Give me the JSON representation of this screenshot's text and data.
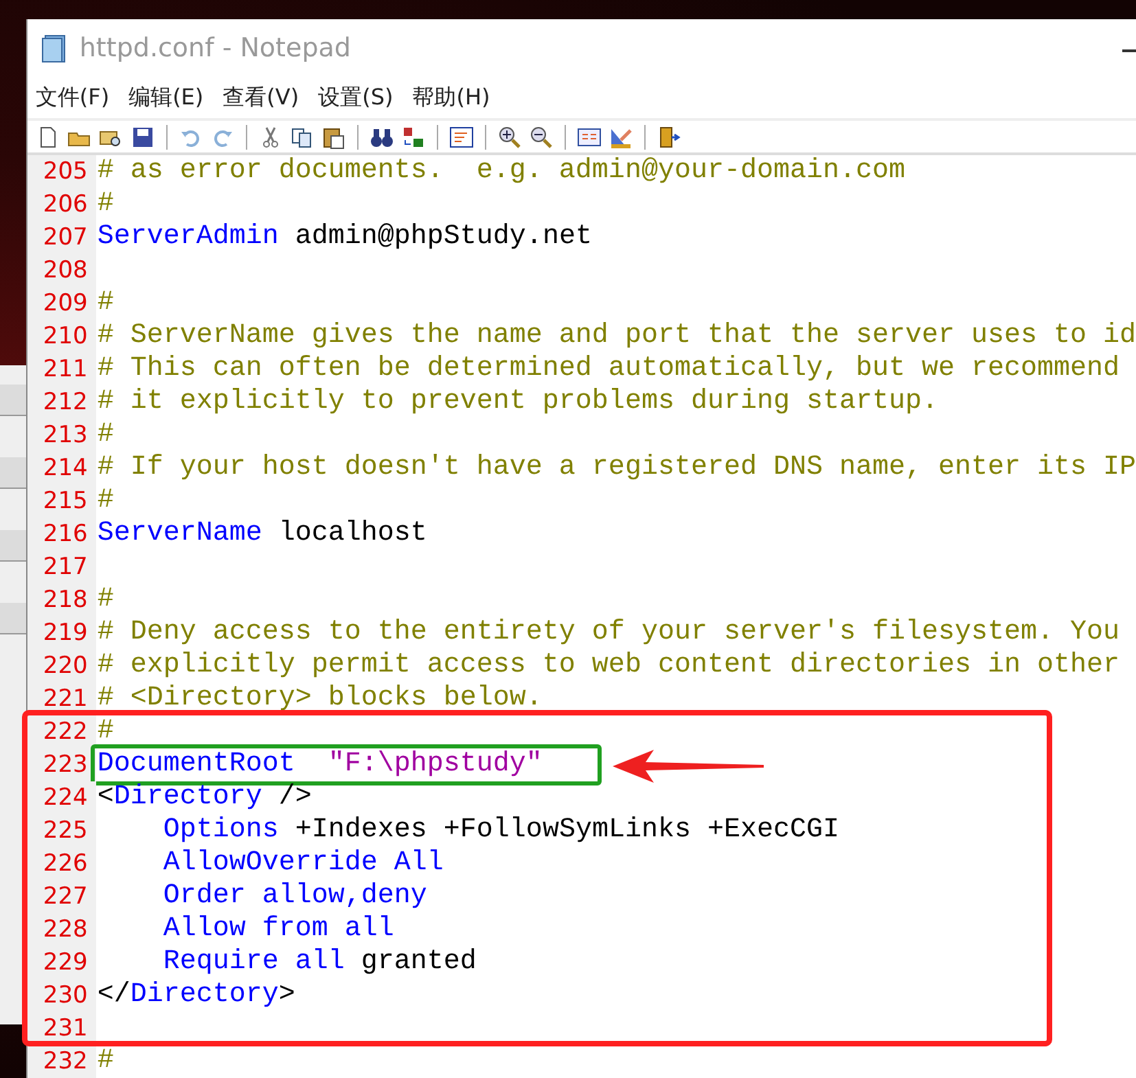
{
  "window": {
    "title": "httpd.conf - Notepad"
  },
  "menu": [
    "文件(F)",
    "编辑(E)",
    "查看(V)",
    "设置(S)",
    "帮助(H)"
  ],
  "lines": [
    {
      "number": "205",
      "segments": [
        {
          "kind": "comment",
          "text": "# as error documents.  e.g. admin@your-domain.com"
        }
      ]
    },
    {
      "number": "206",
      "segments": [
        {
          "kind": "comment",
          "text": "#"
        }
      ]
    },
    {
      "number": "207",
      "segments": [
        {
          "kind": "keyword",
          "text": "ServerAdmin"
        },
        {
          "kind": "plain",
          "text": " admin@phpStudy.net"
        }
      ]
    },
    {
      "number": "208"
    },
    {
      "number": "209",
      "segments": [
        {
          "kind": "comment",
          "text": "#"
        }
      ]
    },
    {
      "number": "210",
      "segments": [
        {
          "kind": "comment",
          "text": "# ServerName gives the name and port that the server uses to id"
        }
      ]
    },
    {
      "number": "211",
      "segments": [
        {
          "kind": "comment",
          "text": "# This can often be determined automatically, but we recommend"
        }
      ]
    },
    {
      "number": "212",
      "segments": [
        {
          "kind": "comment",
          "text": "# it explicitly to prevent problems during startup."
        }
      ]
    },
    {
      "number": "213",
      "segments": [
        {
          "kind": "comment",
          "text": "#"
        }
      ]
    },
    {
      "number": "214",
      "segments": [
        {
          "kind": "comment",
          "text": "# If your host doesn't have a registered DNS name, enter its IP"
        }
      ]
    },
    {
      "number": "215",
      "segments": [
        {
          "kind": "comment",
          "text": "#"
        }
      ]
    },
    {
      "number": "216",
      "segments": [
        {
          "kind": "keyword",
          "text": "ServerName"
        },
        {
          "kind": "plain",
          "text": " localhost"
        }
      ]
    },
    {
      "number": "217"
    },
    {
      "number": "218",
      "segments": [
        {
          "kind": "comment",
          "text": "#"
        }
      ]
    },
    {
      "number": "219",
      "segments": [
        {
          "kind": "comment",
          "text": "# Deny access to the entirety of your server's filesystem. You"
        }
      ]
    },
    {
      "number": "220",
      "segments": [
        {
          "kind": "comment",
          "text": "# explicitly permit access to web content directories in other"
        }
      ]
    },
    {
      "number": "221",
      "segments": [
        {
          "kind": "comment",
          "text": "# <Directory> blocks below."
        }
      ]
    },
    {
      "number": "222",
      "segments": [
        {
          "kind": "comment",
          "text": "#"
        }
      ]
    },
    {
      "number": "223",
      "highlighted": true,
      "segments": [
        {
          "kind": "keyword",
          "text": "DocumentRoot"
        },
        {
          "kind": "string",
          "text": "  \"F:\\phpstudy\""
        }
      ]
    },
    {
      "number": "224",
      "segments": [
        {
          "kind": "plain",
          "text": "<"
        },
        {
          "kind": "keyword",
          "text": "Directory"
        },
        {
          "kind": "plain",
          "text": " />"
        }
      ]
    },
    {
      "number": "225",
      "segments": [
        {
          "kind": "keyword",
          "text": "    Options"
        },
        {
          "kind": "plain",
          "text": " +Indexes +FollowSymLinks +ExecCGI"
        }
      ]
    },
    {
      "number": "226",
      "segments": [
        {
          "kind": "keyword",
          "text": "    AllowOverride All"
        }
      ]
    },
    {
      "number": "227",
      "segments": [
        {
          "kind": "keyword",
          "text": "    Order allow,deny"
        }
      ]
    },
    {
      "number": "228",
      "segments": [
        {
          "kind": "keyword",
          "text": "    Allow from all"
        }
      ]
    },
    {
      "number": "229",
      "segments": [
        {
          "kind": "keyword",
          "text": "    Require all"
        },
        {
          "kind": "plain",
          "text": " granted"
        }
      ]
    },
    {
      "number": "230",
      "segments": [
        {
          "kind": "plain",
          "text": "</"
        },
        {
          "kind": "keyword",
          "text": "Directory"
        },
        {
          "kind": "plain",
          "text": ">"
        }
      ]
    },
    {
      "number": "231"
    },
    {
      "number": "232",
      "segments": [
        {
          "kind": "comment",
          "text": "#"
        }
      ]
    }
  ]
}
